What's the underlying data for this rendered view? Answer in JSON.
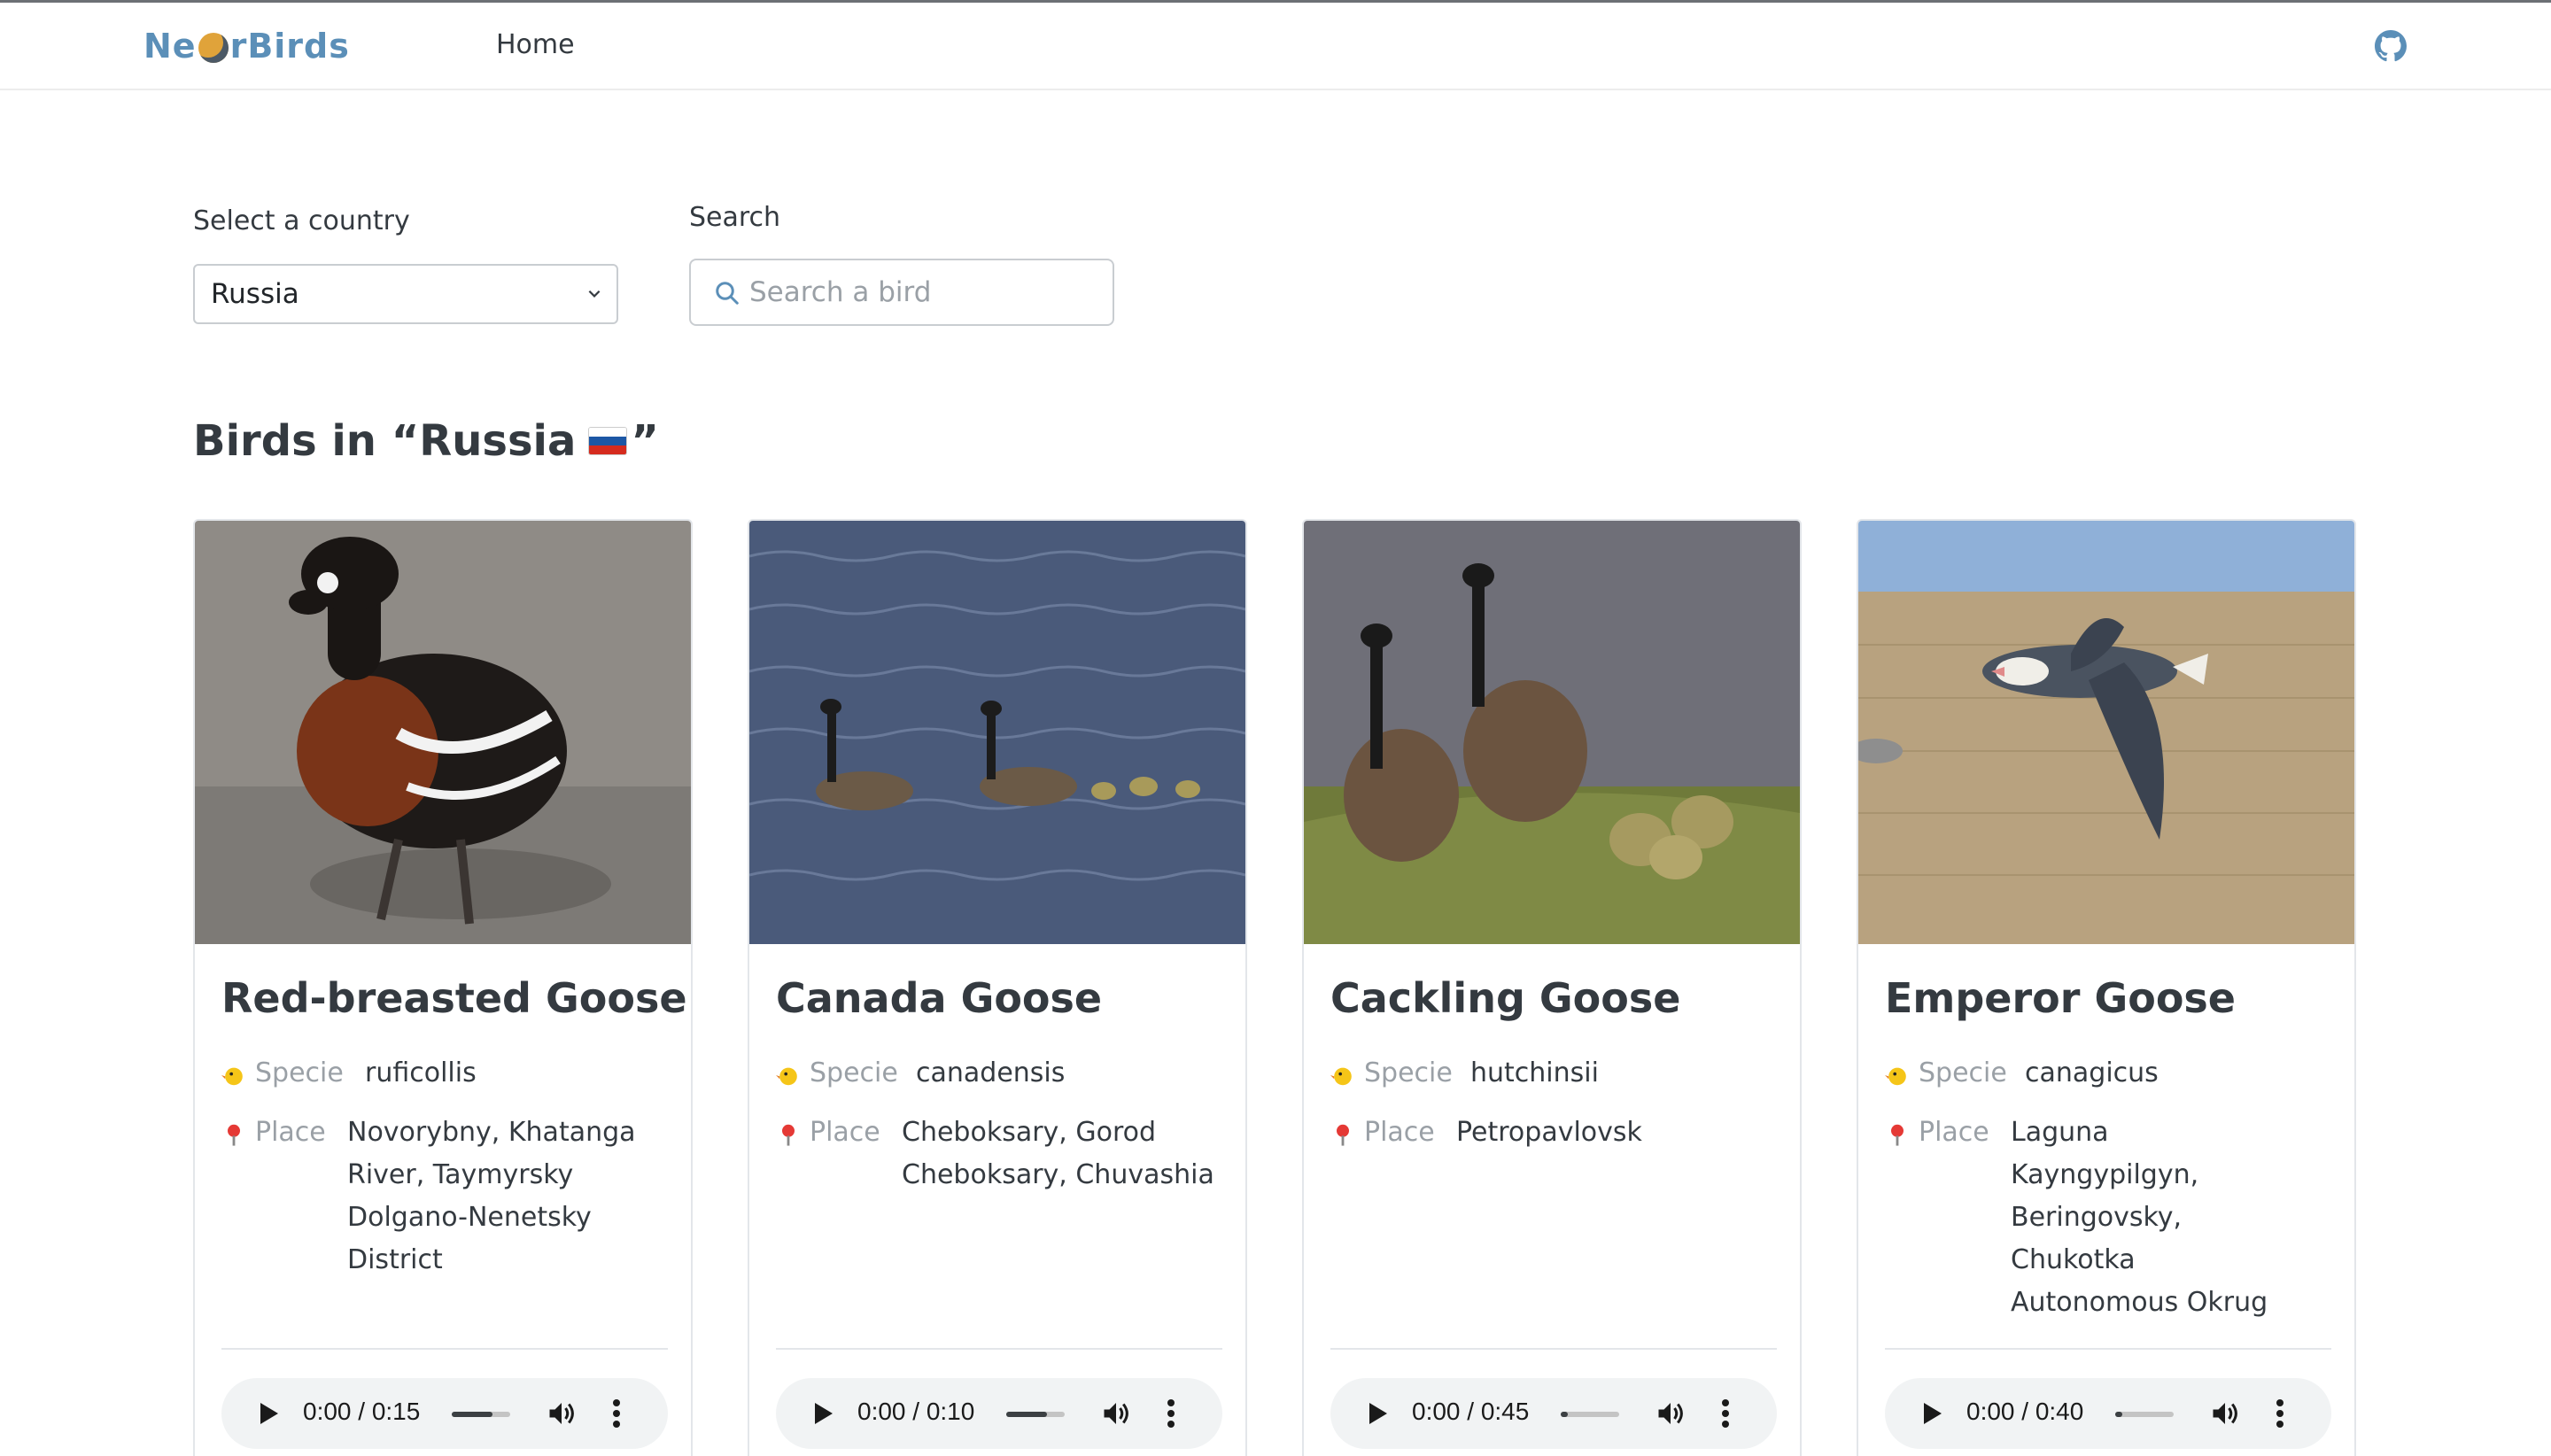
{
  "nav": {
    "logo_left": "Ne",
    "logo_right": "rBirds",
    "home_label": "Home",
    "github_icon": "github-icon"
  },
  "filters": {
    "country_label": "Select a country",
    "country_value": "Russia",
    "search_label": "Search",
    "search_placeholder": "Search a bird"
  },
  "section": {
    "title_prefix": "Birds in “Russia",
    "title_suffix": "”",
    "flag_colors": [
      "#ffffff",
      "#1c57a5",
      "#d52b1e"
    ]
  },
  "labels": {
    "specie": "Specie",
    "place": "Place"
  },
  "birds": [
    {
      "name": "Red-breasted Goose",
      "specie": "ruficollis",
      "place": "Novorybny, Khatanga River, Taymyrsky Dolgano-Nenetsky District",
      "time": "0:00 / 0:15",
      "volume_level": 1.0
    },
    {
      "name": "Canada Goose",
      "specie": "canadensis",
      "place": "Cheboksary, Gorod Cheboksary, Chuvashia",
      "time": "0:00 / 0:10",
      "volume_level": 1.0
    },
    {
      "name": "Cackling Goose",
      "specie": "hutchinsii",
      "place": "Petropavlovsk",
      "time": "0:00 / 0:45",
      "volume_level": 0.0
    },
    {
      "name": "Emperor Goose",
      "specie": "canagicus",
      "place": "Laguna Kayngypilgyn, Beringovsky, Chukotka Autonomous Okrug",
      "time": "0:00 / 0:40",
      "volume_level": 0.0
    }
  ]
}
